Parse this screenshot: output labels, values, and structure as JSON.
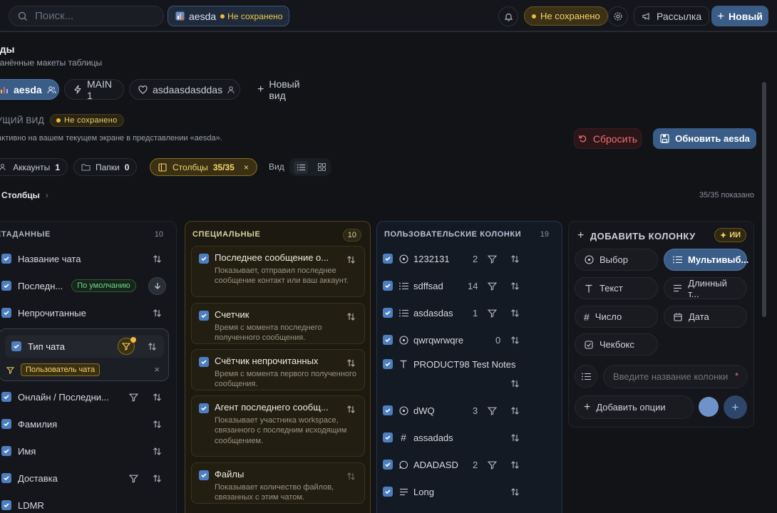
{
  "topbar": {
    "search_placeholder": "Поиск...",
    "view_chip": {
      "label": "aesda",
      "status": "Не сохранено"
    },
    "unsaved_label": "Не сохранено",
    "mailing_label": "Рассылка",
    "new_label": "Новый"
  },
  "panel": {
    "title": "иды",
    "subtitle": "хранённые макеты таблицы",
    "tabs": [
      {
        "label": "aesda"
      },
      {
        "label": "MAIN 1"
      },
      {
        "label": "asdaasdasddas"
      },
      {
        "label": "Новый вид"
      }
    ],
    "current_view": {
      "label": "КУЩИЙ ВИД",
      "status": "Не сохранено"
    },
    "description": "о активно на вашем текущем экране в представлении «aesda».",
    "reset_label": "Сбросить",
    "update_label": "Обновить aesda",
    "filters": [
      {
        "label": "Аккаунты",
        "count": "1"
      },
      {
        "label": "Папки",
        "count": "0"
      },
      {
        "label": "Столбцы",
        "count": "35/35"
      }
    ],
    "view_label": "Вид",
    "breadcrumb": "Столбцы",
    "shown": "35/35 показано"
  },
  "metadata": {
    "title": "ЕТАДАННЫЕ",
    "count": "10",
    "rows": [
      {
        "label": "Название чата"
      },
      {
        "label": "Последн...",
        "badge": "По умолчанию"
      },
      {
        "label": "Непрочитанные"
      },
      {
        "label": "Тип чата",
        "filter_tag": "Пользователь чата"
      },
      {
        "label": "Онлайн / Последни..."
      },
      {
        "label": "Фамилия"
      },
      {
        "label": "Имя"
      },
      {
        "label": "Доставка"
      },
      {
        "label": "LDMR"
      }
    ]
  },
  "special": {
    "title": "СПЕЦИАЛЬНЫЕ",
    "count": "10",
    "cards": [
      {
        "title": "Последнее сообщение о...",
        "desc": "Показывает, отправил последнее сообщение контакт или ваш аккаунт."
      },
      {
        "title": "Счетчик",
        "desc": "Время с момента последнего полученного сообщения."
      },
      {
        "title": "Счётчик непрочитанных",
        "desc": "Время с момента первого полученного сообщения."
      },
      {
        "title": "Агент последнего сообщ...",
        "desc": "Показывает участника workspace, связанного с последним исходящим сообщением."
      },
      {
        "title": "Файлы",
        "desc": "Показывает количество файлов, связанных с этим чатом."
      }
    ]
  },
  "custom": {
    "title": "ПОЛЬЗОВАТЕЛЬСКИЕ КОЛОНКИ",
    "count": "19",
    "rows": [
      {
        "label": "1232131",
        "count": "2",
        "icon": "circle-icon"
      },
      {
        "label": "sdffsad",
        "count": "14",
        "icon": "list-icon"
      },
      {
        "label": "asdasdas",
        "count": "1",
        "icon": "list-icon"
      },
      {
        "label": "qwrqwrwqre",
        "count": "0",
        "icon": "circle-icon"
      },
      {
        "label": "PRODUCT98 Test Notes",
        "count": "",
        "icon": "text-icon"
      },
      {
        "label": "dWQ",
        "count": "3",
        "icon": "circle-icon"
      },
      {
        "label": "assadads",
        "count": "",
        "icon": "hash-icon"
      },
      {
        "label": "ADADASD",
        "count": "2",
        "icon": "comment-icon"
      },
      {
        "label": "Long",
        "count": "",
        "icon": "lines-icon"
      }
    ]
  },
  "add_column": {
    "title": "ДОБАВИТЬ КОЛОНКУ",
    "ai_label": "ИИ",
    "types": [
      "Выбор",
      "Мультивыб...",
      "Текст",
      "Длинный т...",
      "Число",
      "Дата",
      "Чекбокс"
    ],
    "name_placeholder": "Введите название колонки",
    "add_options_label": "Добавить опции"
  },
  "colors": {
    "accent": "#3a5d88",
    "warning": "#f5d46a",
    "danger": "#f06f72",
    "check": "#4d7fc0"
  }
}
